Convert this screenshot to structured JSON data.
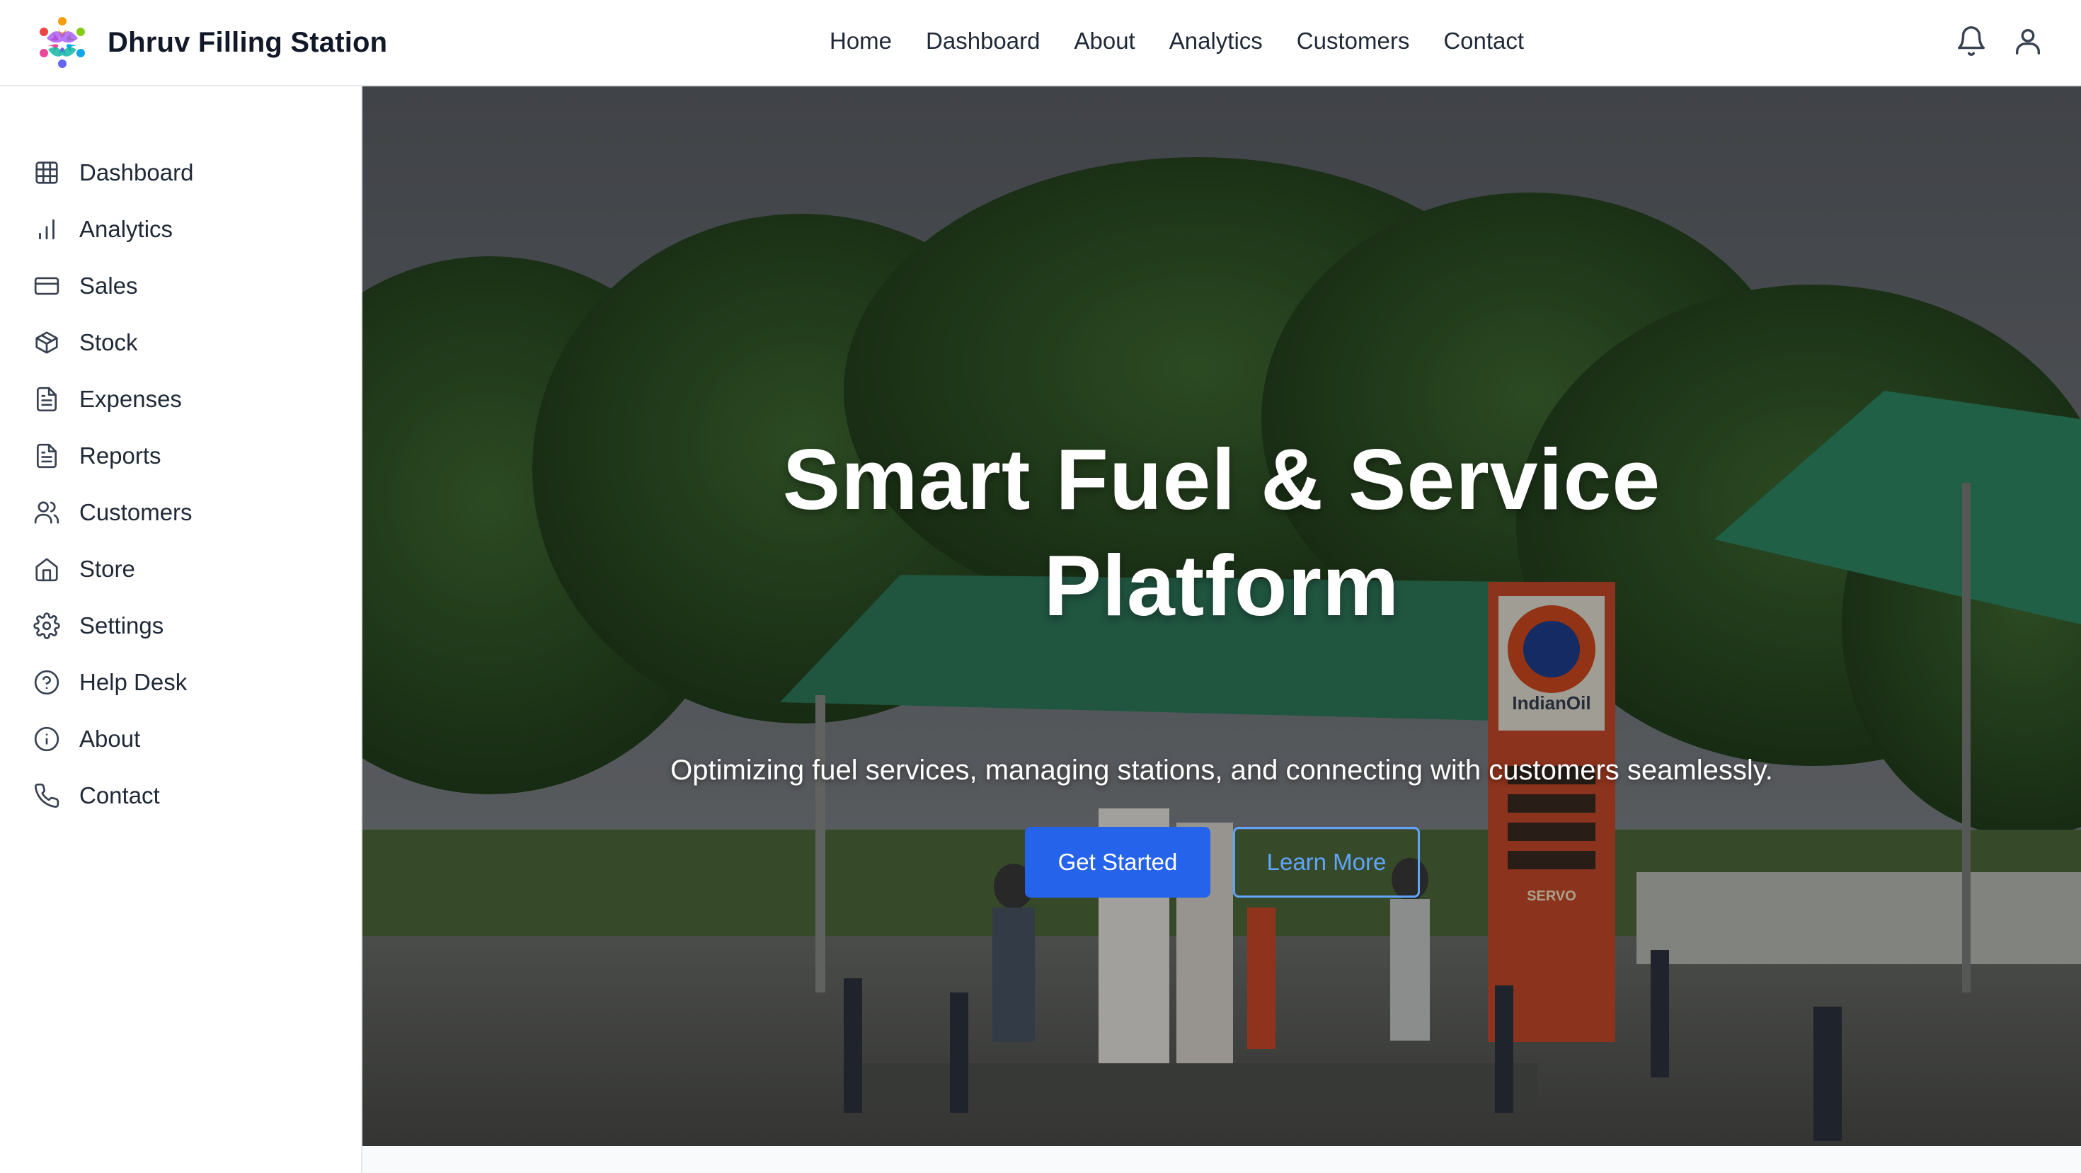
{
  "brand": {
    "name": "Dhruv Filling Station",
    "logo_icon": "colorful-people-circle-logo"
  },
  "topnav": {
    "items": [
      {
        "label": "Home"
      },
      {
        "label": "Dashboard"
      },
      {
        "label": "About"
      },
      {
        "label": "Analytics"
      },
      {
        "label": "Customers"
      },
      {
        "label": "Contact"
      }
    ]
  },
  "top_icons": {
    "notifications": "bell-icon",
    "profile": "user-icon"
  },
  "sidebar": {
    "items": [
      {
        "label": "Dashboard",
        "icon": "grid-icon"
      },
      {
        "label": "Analytics",
        "icon": "bar-chart-icon"
      },
      {
        "label": "Sales",
        "icon": "credit-card-icon"
      },
      {
        "label": "Stock",
        "icon": "package-icon"
      },
      {
        "label": "Expenses",
        "icon": "document-icon"
      },
      {
        "label": "Reports",
        "icon": "document-icon"
      },
      {
        "label": "Customers",
        "icon": "users-icon"
      },
      {
        "label": "Store",
        "icon": "home-icon"
      },
      {
        "label": "Settings",
        "icon": "gear-icon"
      },
      {
        "label": "Help Desk",
        "icon": "help-circle-icon"
      },
      {
        "label": "About",
        "icon": "info-icon"
      },
      {
        "label": "Contact",
        "icon": "phone-icon"
      }
    ]
  },
  "hero": {
    "title_line1": "Smart Fuel & Service",
    "title_line2": "Platform",
    "subtitle": "Optimizing fuel services, managing stations, and connecting with customers seamlessly.",
    "primary_button": "Get Started",
    "secondary_button": "Learn More",
    "background_image": "fuel-station-photo",
    "sign_text": "IndianOil",
    "sign_subtext": "SERVO"
  },
  "colors": {
    "accent": "#2563eb",
    "outline_button": "#60a5fa",
    "text": "#1f2937",
    "border": "#e5e7eb"
  }
}
